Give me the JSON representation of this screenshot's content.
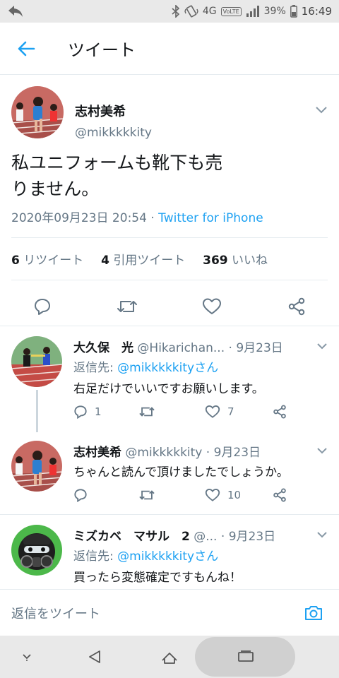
{
  "status_bar": {
    "network": "4G",
    "volte": "VoLTE",
    "battery": "39%",
    "time": "16:49"
  },
  "header": {
    "title": "ツイート"
  },
  "main_tweet": {
    "author_name": "志村美希",
    "author_handle": "@mikkkkkity",
    "text_line1": "私ユニフォームも靴下も売",
    "text_line2": "りません。",
    "timestamp": "2020年09月23日 20:54 · ",
    "source": "Twitter for iPhone",
    "retweets_count": "6",
    "retweets_label": "リツイート",
    "quotes_count": "4",
    "quotes_label": "引用ツイート",
    "likes_count": "369",
    "likes_label": "いいね"
  },
  "replies": [
    {
      "name": "大久保　光",
      "handle": "@Hikarichan...",
      "dot": " · ",
      "date": "9月23日",
      "replying_to_label": "返信先: ",
      "replying_to_mention": "@mikkkkkityさん",
      "text": "右足だけでいいですお願いします。",
      "reply_count": "1",
      "retweet_count": "",
      "like_count": "7"
    },
    {
      "name": "志村美希",
      "handle": "@mikkkkkity",
      "dot": " · ",
      "date": "9月23日",
      "text": "ちゃんと読んで頂けましたでしょうか。",
      "reply_count": "",
      "retweet_count": "",
      "like_count": "10"
    },
    {
      "name": "ミズカベ　マサル　2",
      "handle": "@...",
      "dot": " · ",
      "date": "9月23日",
      "replying_to_label": "返信先: ",
      "replying_to_mention": "@mikkkkkityさん",
      "text": "買ったら変態確定ですもんね！"
    }
  ],
  "compose": {
    "placeholder": "返信をツイート"
  },
  "colors": {
    "accent": "#1da1f2",
    "muted": "#657786",
    "text": "#14171a"
  }
}
